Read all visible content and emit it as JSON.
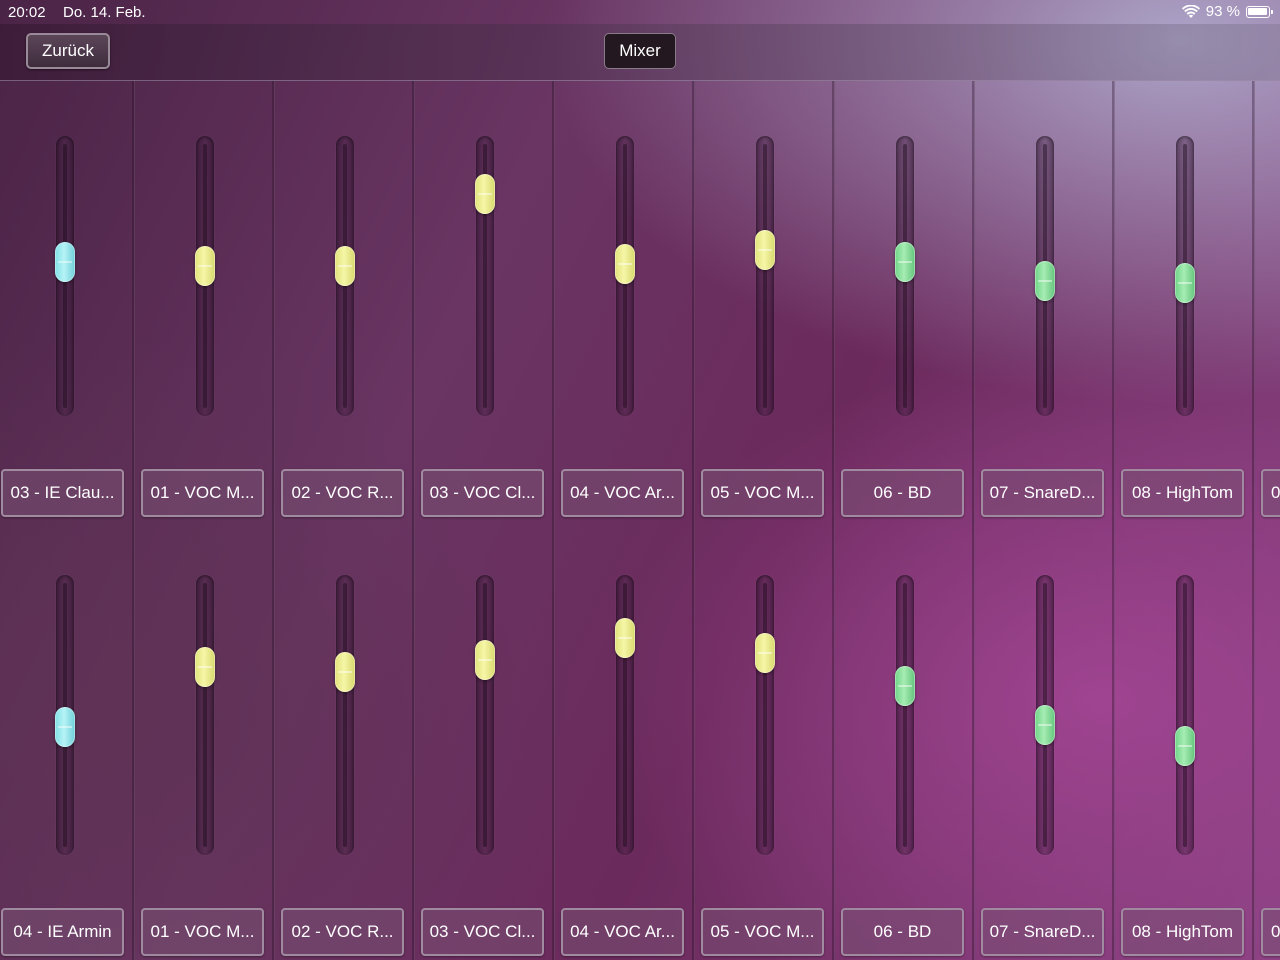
{
  "status_bar": {
    "time": "20:02",
    "date": "Do. 14. Feb.",
    "battery": "93 %",
    "wifi_icon": "wifi-icon",
    "battery_icon": "battery-icon"
  },
  "nav": {
    "back_label": "Zurück",
    "title": "Mixer"
  },
  "rows": [
    {
      "channels": [
        {
          "label": "03 - IE Clau...",
          "level": 0.56,
          "color": "cyan"
        },
        {
          "label": "01 - VOC M...",
          "level": 0.54,
          "color": "yellow"
        },
        {
          "label": "02 - VOC R...",
          "level": 0.54,
          "color": "yellow"
        },
        {
          "label": "03 - VOC Cl...",
          "level": 0.84,
          "color": "yellow"
        },
        {
          "label": "04 - VOC Ar...",
          "level": 0.55,
          "color": "yellow"
        },
        {
          "label": "05 - VOC M...",
          "level": 0.61,
          "color": "yellow"
        },
        {
          "label": "06 - BD",
          "level": 0.56,
          "color": "green"
        },
        {
          "label": "07 - SnareD...",
          "level": 0.48,
          "color": "green"
        },
        {
          "label": "08 - HighTom",
          "level": 0.47,
          "color": "green"
        },
        {
          "label": "0",
          "level": null,
          "color": ""
        }
      ]
    },
    {
      "channels": [
        {
          "label": "04 - IE Armin",
          "level": 0.45,
          "color": "cyan"
        },
        {
          "label": "01 - VOC M...",
          "level": 0.7,
          "color": "yellow"
        },
        {
          "label": "02 - VOC R...",
          "level": 0.68,
          "color": "yellow"
        },
        {
          "label": "03 - VOC Cl...",
          "level": 0.73,
          "color": "yellow"
        },
        {
          "label": "04 - VOC Ar...",
          "level": 0.82,
          "color": "yellow"
        },
        {
          "label": "05 - VOC M...",
          "level": 0.76,
          "color": "yellow"
        },
        {
          "label": "06 - BD",
          "level": 0.62,
          "color": "green"
        },
        {
          "label": "07 - SnareD...",
          "level": 0.46,
          "color": "green"
        },
        {
          "label": "08 - HighTom",
          "level": 0.37,
          "color": "green"
        },
        {
          "label": "0",
          "level": null,
          "color": ""
        }
      ]
    }
  ]
}
